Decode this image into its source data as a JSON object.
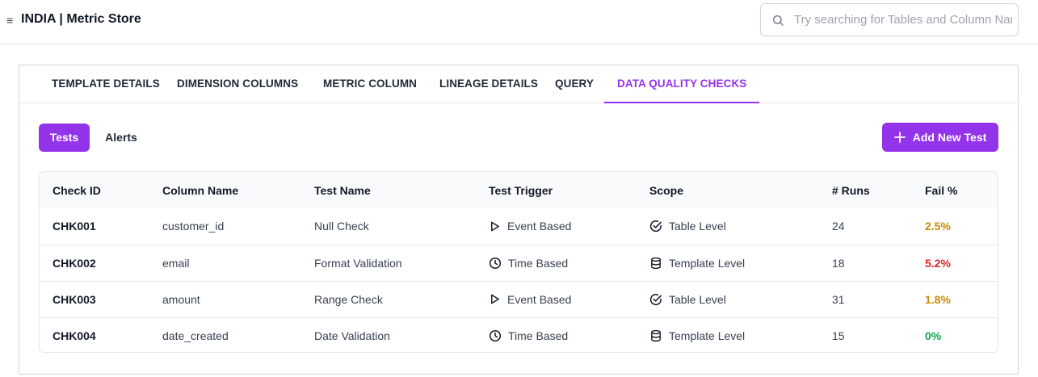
{
  "header": {
    "menu_glyph": "≡",
    "title": "INDIA | Metric Store",
    "search_placeholder": "Try searching for Tables and Column Names"
  },
  "tabs": [
    {
      "label": "TEMPLATE DETAILS",
      "active": false
    },
    {
      "label": "DIMENSION COLUMNS",
      "active": false
    },
    {
      "label": "METRIC COLUMN",
      "active": false
    },
    {
      "label": "LINEAGE DETAILS",
      "active": false
    },
    {
      "label": "QUERY",
      "active": false
    },
    {
      "label": "DATA QUALITY CHECKS",
      "active": true
    }
  ],
  "subtabs": [
    {
      "label": "Tests",
      "active": true
    },
    {
      "label": "Alerts",
      "active": false
    }
  ],
  "add_button": {
    "label": "Add New Test",
    "icon": "plus-icon"
  },
  "colors": {
    "accent": "#9333ea",
    "warn": "#ca8a04",
    "danger": "#dc2626",
    "ok": "#16a34a"
  },
  "table": {
    "columns": [
      "Check ID",
      "Column Name",
      "Test Name",
      "Test Trigger",
      "Scope",
      "# Runs",
      "Fail %"
    ],
    "rows": [
      {
        "check_id": "CHK001",
        "column": "customer_id",
        "test": "Null Check",
        "trigger": "Event Based",
        "trigger_icon": "play-icon",
        "scope": "Table Level",
        "scope_icon": "check-circle-icon",
        "runs": "24",
        "fail": "2.5%",
        "fail_status": "warn"
      },
      {
        "check_id": "CHK002",
        "column": "email",
        "test": "Format Validation",
        "trigger": "Time Based",
        "trigger_icon": "clock-icon",
        "scope": "Template Level",
        "scope_icon": "database-icon",
        "runs": "18",
        "fail": "5.2%",
        "fail_status": "danger"
      },
      {
        "check_id": "CHK003",
        "column": "amount",
        "test": "Range Check",
        "trigger": "Event Based",
        "trigger_icon": "play-icon",
        "scope": "Table Level",
        "scope_icon": "check-circle-icon",
        "runs": "31",
        "fail": "1.8%",
        "fail_status": "warn"
      },
      {
        "check_id": "CHK004",
        "column": "date_created",
        "test": "Date Validation",
        "trigger": "Time Based",
        "trigger_icon": "clock-icon",
        "scope": "Template Level",
        "scope_icon": "database-icon",
        "runs": "15",
        "fail": "0%",
        "fail_status": "ok"
      }
    ]
  }
}
